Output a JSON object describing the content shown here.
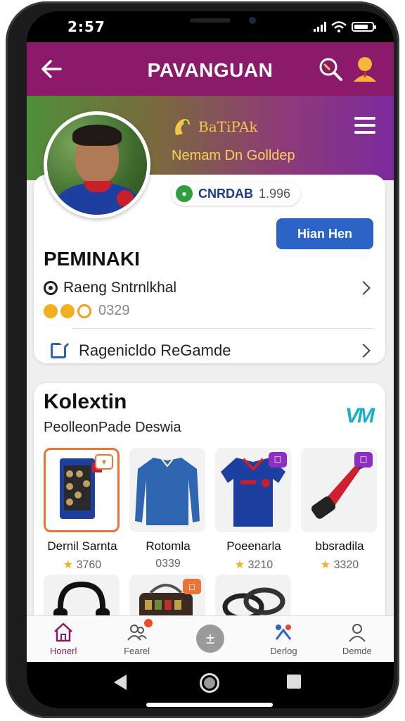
{
  "status_bar": {
    "time": "2:57"
  },
  "app_bar": {
    "title": "PAVANGUAN"
  },
  "banner": {
    "brand": "BaTiPAk",
    "tagline": "Nemam Dn Golldep"
  },
  "profile": {
    "rating_label": "CNRDAB",
    "rating_value": "1.996",
    "follow_button": "Hian Hen",
    "name": "PEMINAKI",
    "skill": "Raeng Sntrnlkhal",
    "points": "0329",
    "recommend": "Ragenicldo ReGamde"
  },
  "collection": {
    "title": "Kolextin",
    "subtitle": "PeolleonPade Deswia",
    "logo": "VM",
    "products": [
      {
        "name": "Dernil Sarnta",
        "rating": "3760"
      },
      {
        "name": "Rotomla",
        "rating": "0339"
      },
      {
        "name": "Poeenarla",
        "rating": "3210"
      },
      {
        "name": "bbsradila",
        "rating": "3320"
      }
    ]
  },
  "bottom_nav": {
    "items": [
      {
        "label": "Honerl"
      },
      {
        "label": "Fearel"
      },
      {
        "label": ""
      },
      {
        "label": "Derlog"
      },
      {
        "label": "Demde"
      }
    ]
  },
  "colors": {
    "primary": "#8b1a6b",
    "accent_blue": "#2b63c6",
    "gold": "#f4c54a"
  }
}
